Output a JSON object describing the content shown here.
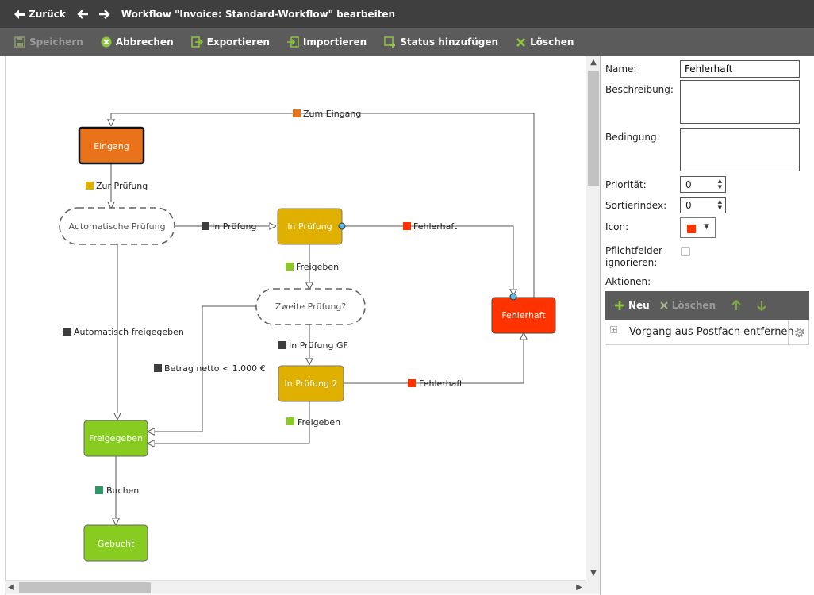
{
  "titlebar": {
    "back_label": "Zurück",
    "title": "Workflow \"Invoice: Standard-Workflow\" bearbeiten"
  },
  "toolbar": {
    "save_label": "Speichern",
    "cancel_label": "Abbrechen",
    "export_label": "Exportieren",
    "import_label": "Importieren",
    "add_status_label": "Status hinzufügen",
    "delete_label": "Löschen"
  },
  "workflow": {
    "states": {
      "eingang": "Eingang",
      "automatische_pruefung": "Automatische Prüfung",
      "in_pruefung": "In Prüfung",
      "zweite_pruefung": "Zweite Prüfung?",
      "in_pruefung_2": "In Prüfung 2",
      "fehlerhaft": "Fehlerhaft",
      "freigegeben": "Freigegeben",
      "gebucht": "Gebucht"
    },
    "transitions": {
      "zum_eingang": "Zum Eingang",
      "zur_pruefung": "Zur Prüfung",
      "in_pruefung": "In Prüfung",
      "fehlerhaft_1": "Fehlerhaft",
      "freigeben_1": "Freigeben",
      "automatisch_freigegeben": "Automatisch freigegeben",
      "betrag_netto": "Betrag netto < 1.000 €",
      "in_pruefung_gf": "In Prüfung GF",
      "fehlerhaft_2": "Fehlerhaft",
      "freigeben_2": "Freigeben",
      "buchen": "Buchen"
    },
    "colors": {
      "orange": "#e8731a",
      "yellow": "#e0b000",
      "red": "#ff3300",
      "green": "#88cc22",
      "dark": "#3d3d3d",
      "teal": "#2e9966"
    }
  },
  "properties": {
    "name_label": "Name:",
    "name_value": "Fehlerhaft",
    "description_label": "Beschreibung:",
    "description_value": "",
    "condition_label": "Bedingung:",
    "condition_value": "",
    "priority_label": "Priorität:",
    "priority_value": "0",
    "sort_label": "Sortierindex:",
    "sort_value": "0",
    "icon_label": "Icon:",
    "icon_color": "#ff3300",
    "mandatory_label_1": "Pflichtfelder",
    "mandatory_label_2": "ignorieren:",
    "mandatory_checked": false,
    "actions_label": "Aktionen:",
    "actions_new_label": "Neu",
    "actions_delete_label": "Löschen",
    "actions": [
      "Vorgang aus Postfach entfernen"
    ]
  }
}
